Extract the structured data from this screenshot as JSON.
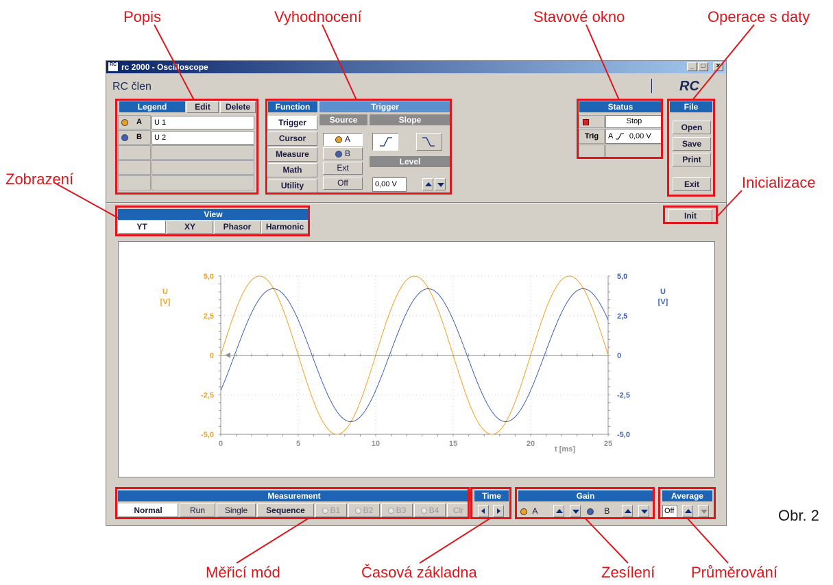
{
  "callouts": {
    "popis": "Popis",
    "vyhodnoceni": "Vyhodnocení",
    "stavove_okno": "Stavové okno",
    "operace_s_daty": "Operace s daty",
    "zobrazeni": "Zobrazení",
    "inicializace": "Inicializace",
    "obr": "Obr. 2",
    "merici_mod": "Měřicí mód",
    "casova_zakladna": "Časová základna",
    "zesileni": "Zesílení",
    "prumerovani": "Průměrování"
  },
  "window": {
    "icon_text": "RC",
    "title": "rc 2000 - Oscilloscope",
    "subtitle": "RC člen",
    "logo": "RC"
  },
  "legend": {
    "header": "Legend",
    "edit": "Edit",
    "delete": "Delete",
    "rows": [
      {
        "channel": "A",
        "label": "U 1",
        "color": "#f0a020"
      },
      {
        "channel": "B",
        "label": "U 2",
        "color": "#4060b8"
      }
    ]
  },
  "function": {
    "header": "Function",
    "items": [
      "Trigger",
      "Cursor",
      "Measure",
      "Math",
      "Utility"
    ],
    "active": "Trigger"
  },
  "trigger": {
    "header": "Trigger",
    "source_header": "Source",
    "slope_header": "Slope",
    "level_header": "Level",
    "sources": [
      "A",
      "B",
      "Ext",
      "Off"
    ],
    "level_value": "0,00 V"
  },
  "status": {
    "header": "Status",
    "state": "Stop",
    "trig_label": "Trig",
    "trig_channel": "A",
    "trig_value": "0,00 V",
    "led_color": "#e02020"
  },
  "file": {
    "header": "File",
    "open": "Open",
    "save": "Save",
    "print": "Print",
    "exit": "Exit"
  },
  "view": {
    "header": "View",
    "tabs": [
      "YT",
      "XY",
      "Phasor",
      "Harmonic"
    ],
    "active": "YT"
  },
  "init_label": "Init",
  "measurement": {
    "header": "Measurement",
    "normal": "Normal",
    "run": "Run",
    "single": "Single",
    "sequence": "Sequence",
    "b1": "B1",
    "b2": "B2",
    "b3": "B3",
    "b4": "B4",
    "clr": "Clr"
  },
  "time": {
    "header": "Time"
  },
  "gain": {
    "header": "Gain",
    "a": "A",
    "b": "B"
  },
  "average": {
    "header": "Average",
    "value": "Off"
  },
  "chart_data": {
    "type": "line",
    "x_label": "t [ms]",
    "x_ticks": [
      "0",
      "5",
      "10",
      "15",
      "20",
      "25"
    ],
    "xlim": [
      0,
      25
    ],
    "left_axis": {
      "label_line1": "U",
      "label_line2": "[V]",
      "ticks": [
        "5,0",
        "2,5",
        "0",
        "-2,5",
        "-5,0"
      ],
      "color": "#f0a020"
    },
    "right_axis": {
      "label_line1": "U",
      "label_line2": "[V]",
      "ticks": [
        "5,0",
        "2,5",
        "0",
        "-2,5",
        "-5,0"
      ],
      "color": "#4060b8"
    },
    "ylim": [
      -5,
      5
    ],
    "grid": true,
    "series": [
      {
        "name": "U 1",
        "amplitude": 5.0,
        "period_ms": 10,
        "phase_deg": 0,
        "color": "#f0a020"
      },
      {
        "name": "U 2",
        "amplitude": 4.2,
        "period_ms": 10,
        "phase_deg": -32,
        "color": "#4060b8"
      }
    ]
  }
}
